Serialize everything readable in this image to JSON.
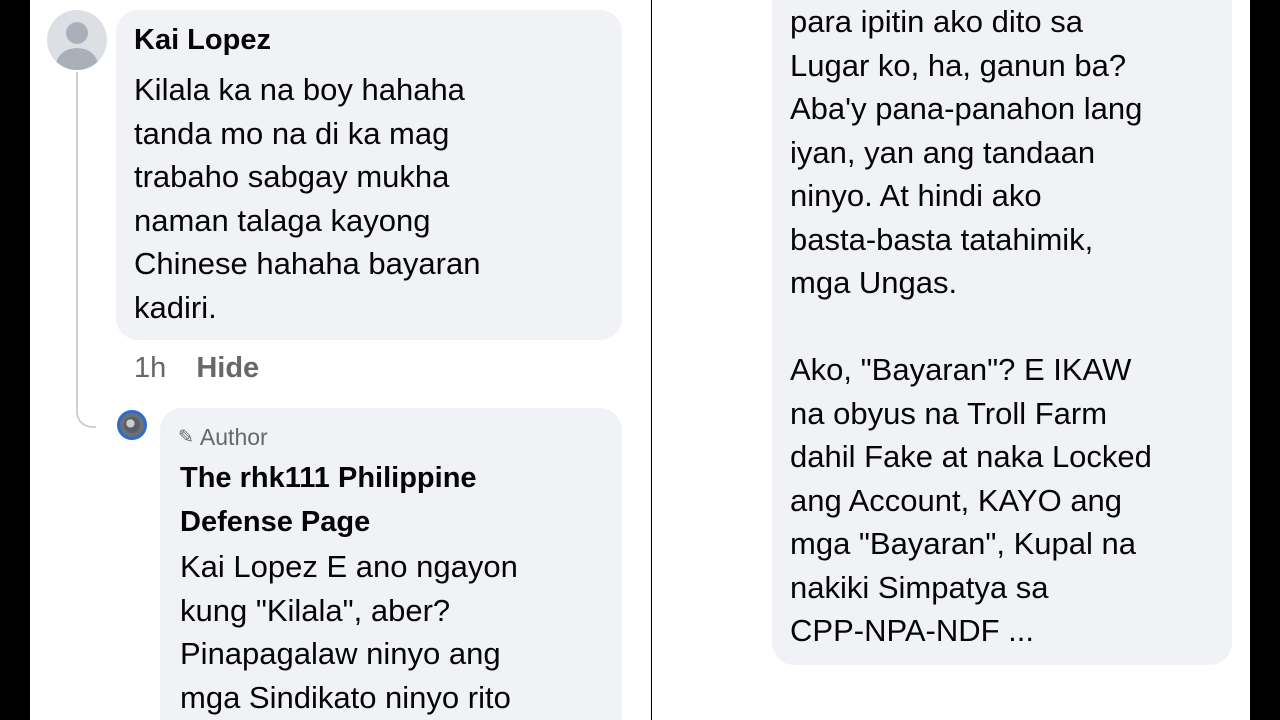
{
  "comment": {
    "author": "Kai Lopez",
    "text": "Kilala ka na boy hahaha\ntanda mo na di ka mag\ntrabaho sabgay mukha\nnaman talaga kayong\nChinese hahaha bayaran\nkadiri.",
    "time": "1h",
    "hide_label": "Hide"
  },
  "reply": {
    "badge_icon": "pen-icon",
    "badge_label": "Author",
    "author": "The rhk111 Philippine\nDefense Page",
    "text_visible": "Kai Lopez E ano ngayon\nkung \"Kilala\", aber?\nPinapagalaw ninyo ang\nmga Sindikato ninyo rito",
    "text_continued": "para ipitin ako dito sa\nLugar ko, ha, ganun ba?\nAba'y pana-panahon lang\niyan, yan ang tandaan\nninyo. At hindi ako\nbasta-basta tatahimik,\nmga Ungas.\n\nAko, \"Bayaran\"? E IKAW\nna obyus na Troll Farm\ndahil Fake at naka Locked\nang Account, KAYO ang\nmga \"Bayaran\", Kupal na\nnakiki Simpatya sa\nCPP-NPA-NDF ..."
  }
}
